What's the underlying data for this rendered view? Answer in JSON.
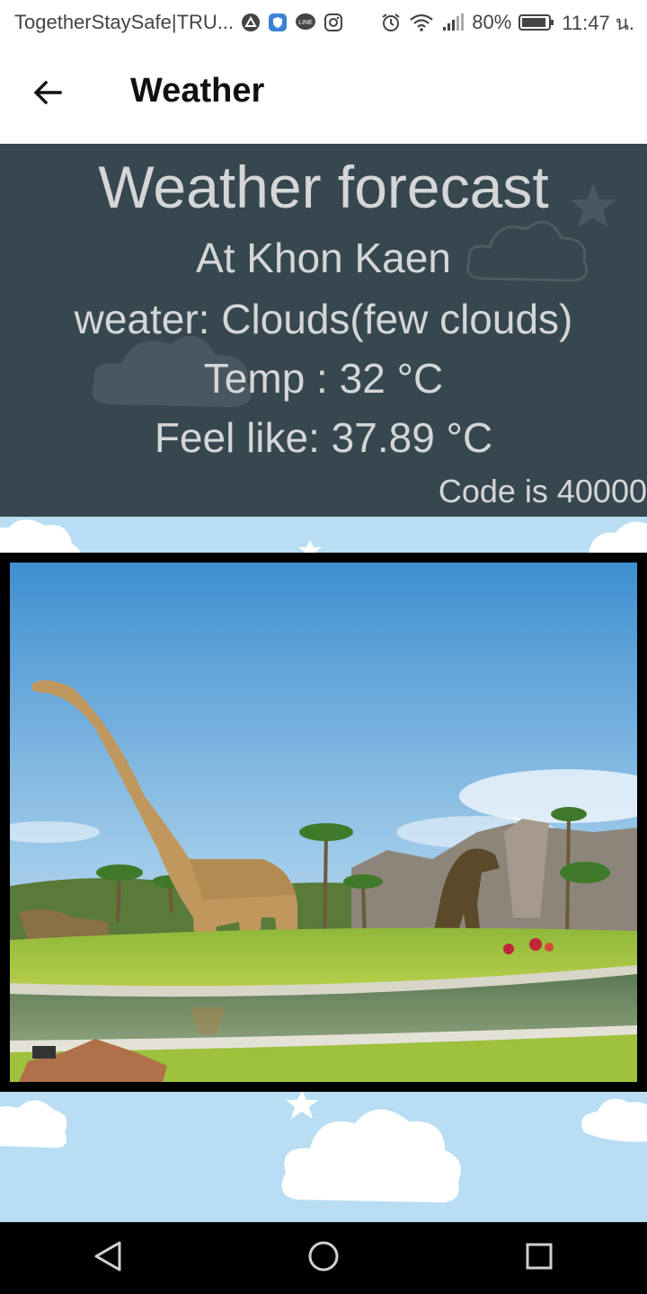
{
  "status_bar": {
    "notification_text": "TogetherStaySafe|TRU...",
    "battery": "80%",
    "time": "11:47 น."
  },
  "app_bar": {
    "title": "Weather"
  },
  "forecast": {
    "heading": "Weather forecast",
    "location": "At Khon Kaen",
    "weather": "weater: Clouds(few clouds)",
    "temp": "Temp : 32 °C",
    "feels_like": "Feel like: 37.89 °C",
    "code": "Code is 40000"
  },
  "colors": {
    "panel_bg": "#37474f",
    "panel_text": "#d4d6d8",
    "sky": "#b9def3"
  },
  "icons": [
    "back-arrow-icon",
    "nav-back-icon",
    "nav-home-icon",
    "nav-recents-icon",
    "alarm-icon",
    "wifi-icon",
    "signal-icon",
    "battery-icon"
  ]
}
